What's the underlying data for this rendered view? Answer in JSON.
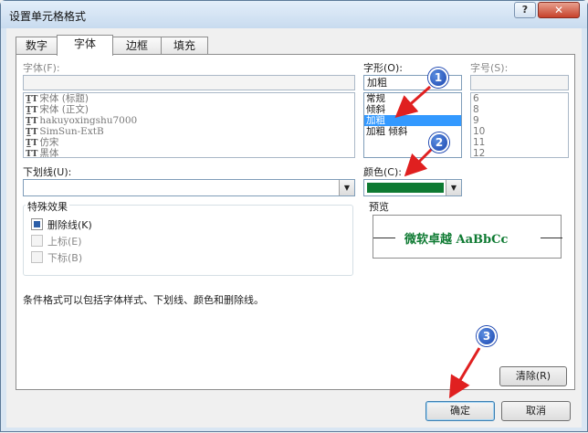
{
  "window": {
    "title": "设置单元格格式",
    "help_label": "?",
    "close_label": "✕"
  },
  "tabs": [
    "数字",
    "字体",
    "边框",
    "填充"
  ],
  "font": {
    "label": "字体(F):",
    "value": "",
    "items": [
      "宋体 (标题)",
      "宋体 (正文)",
      "hakuyoxingshu7000",
      "SimSun-ExtB",
      "仿宋",
      "黑体"
    ]
  },
  "style": {
    "label": "字形(O):",
    "value": "加粗",
    "items": [
      "常规",
      "倾斜",
      "加粗",
      "加粗 倾斜"
    ],
    "selected_index": 2
  },
  "size": {
    "label": "字号(S):",
    "value": "",
    "items": [
      "6",
      "8",
      "9",
      "10",
      "11",
      "12"
    ]
  },
  "underline": {
    "label": "下划线(U):",
    "value": ""
  },
  "color": {
    "label": "颜色(C):",
    "value_hex": "#0e7a32"
  },
  "effects": {
    "title": "特殊效果",
    "items": [
      {
        "label": "删除线(K)",
        "checked": true,
        "enabled": true
      },
      {
        "label": "上标(E)",
        "checked": false,
        "enabled": false
      },
      {
        "label": "下标(B)",
        "checked": false,
        "enabled": false
      }
    ]
  },
  "preview": {
    "title": "预览",
    "text": "微软卓越  AaBbCc"
  },
  "info_text": "条件格式可以包括字体样式、下划线、颜色和删除线。",
  "buttons": {
    "clear": "清除(R)",
    "ok": "确定",
    "cancel": "取消"
  },
  "annotations": [
    "1",
    "2",
    "3"
  ],
  "colors": {
    "selection": "#3399ff",
    "preview_text": "#0e7a32",
    "badge": "#1c46b0",
    "arrow": "#e02020"
  }
}
